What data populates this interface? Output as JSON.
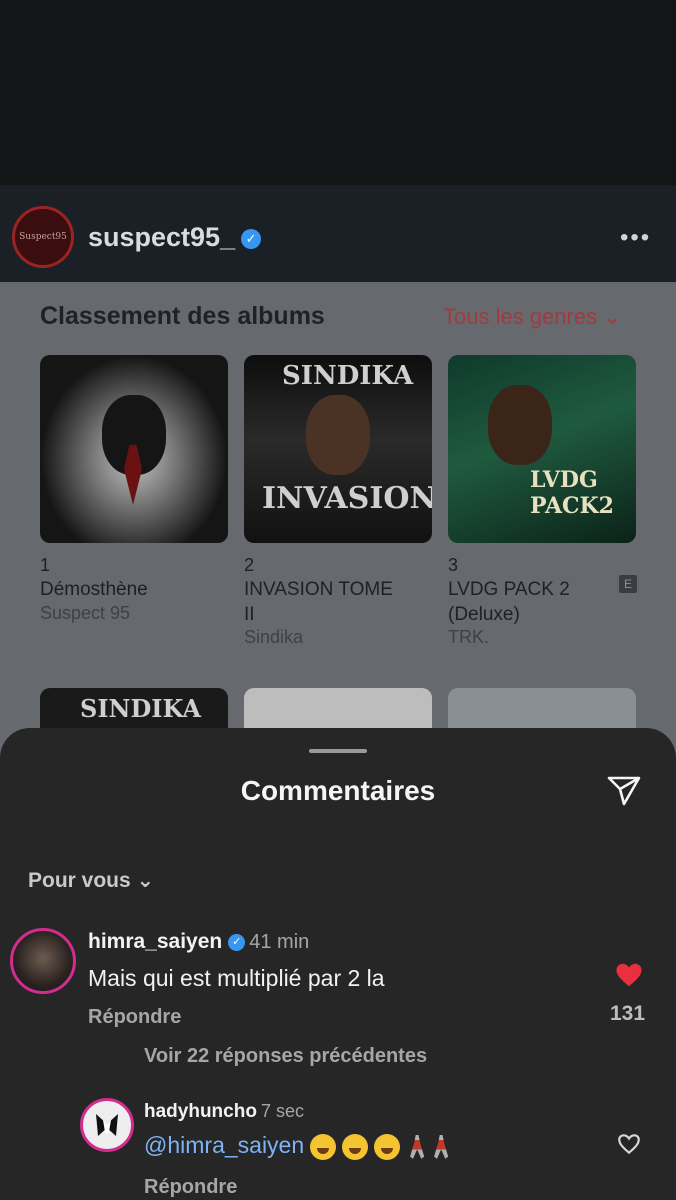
{
  "post": {
    "username": "suspect95_",
    "avatar_text": "Suspect95"
  },
  "music_card": {
    "title": "Classement des albums",
    "filter_label": "Tous les genres ⌄",
    "albums": [
      {
        "rank": "1",
        "name": "Démosthène",
        "artist": "Suspect 95"
      },
      {
        "rank": "2",
        "name": "INVASION TOME II",
        "artist": "Sindika",
        "cover_text_top": "SINDIKA",
        "cover_text_bottom": "INVASION"
      },
      {
        "rank": "3",
        "name": "LVDG PACK 2 (Deluxe)",
        "artist": "TRK.",
        "explicit": "E",
        "cover_text": "LVDG PACK2"
      }
    ],
    "second_row_cover_text": "SINDIKA"
  },
  "comments_sheet": {
    "title": "Commentaires",
    "filter": "Pour vous ⌄",
    "comments": [
      {
        "username": "himra_saiyen",
        "time": "41 min",
        "text": "Mais qui est multiplié par 2 la",
        "reply": "Répondre",
        "likes": "131"
      },
      {
        "username": "hadyhuncho",
        "time": "7 sec",
        "mention": "@himra_saiyen",
        "reply": "Répondre"
      }
    ],
    "view_replies": "Voir 22 réponses précédentes"
  },
  "colors": {
    "accent_like": "#e8303f",
    "verified": "#3797f0",
    "mention": "#7fb3f5"
  }
}
